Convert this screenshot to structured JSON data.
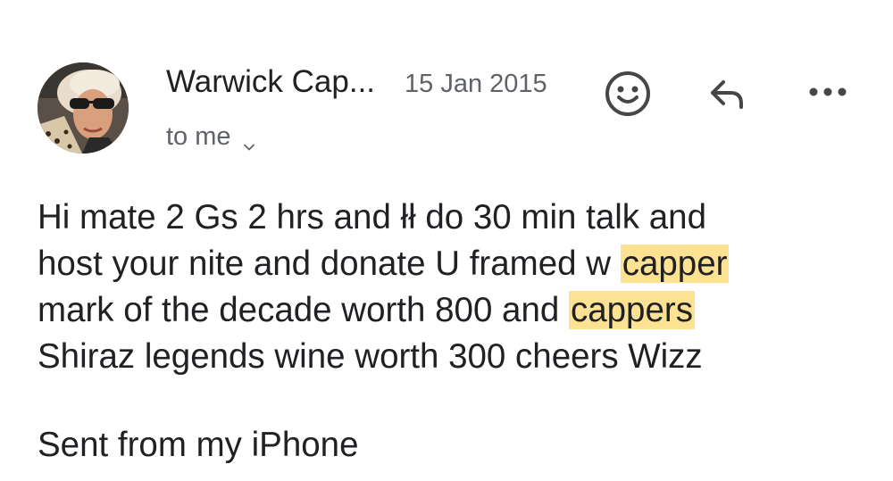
{
  "message": {
    "sender_name": "Warwick Cap...",
    "date": "15 Jan 2015",
    "recipient": "to me",
    "actions": {
      "emoji_icon": "smiley-face-icon",
      "reply_icon": "reply-arrow-icon",
      "more_icon": "more-dots-icon"
    },
    "body_lines": [
      {
        "text": "Hi mate 2 Gs 2 hrs and łł do 30 min talk and",
        "highlight": ""
      },
      {
        "text": "host your nite and donate U framed w ",
        "highlight": "capper"
      },
      {
        "text": "mark of the decade worth 800 and ",
        "highlight": "cappers"
      },
      {
        "text": "Shiraz legends wine worth 300 cheers Wizz",
        "highlight": ""
      }
    ],
    "signature": "Sent from my iPhone",
    "highlight_color": "#fde293"
  }
}
